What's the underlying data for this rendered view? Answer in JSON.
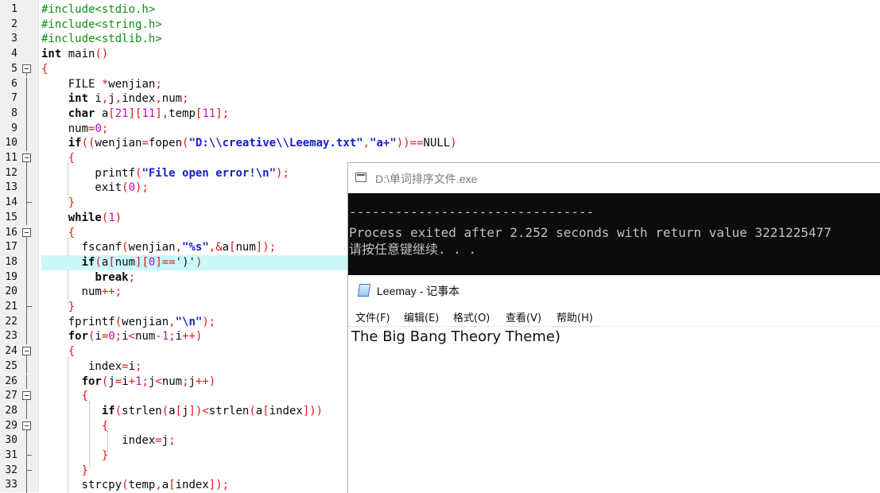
{
  "editor": {
    "lines": [
      {
        "n": "1",
        "fold": "none",
        "segs": [
          {
            "t": "#include<stdio.h>",
            "c": "pp"
          }
        ]
      },
      {
        "n": "2",
        "fold": "none",
        "segs": [
          {
            "t": "#include<string.h>",
            "c": "pp"
          }
        ]
      },
      {
        "n": "3",
        "fold": "none",
        "segs": [
          {
            "t": "#include<stdlib.h>",
            "c": "pp"
          }
        ]
      },
      {
        "n": "4",
        "fold": "none",
        "segs": [
          {
            "t": "int",
            "c": "kw"
          },
          {
            "t": " main",
            "c": ""
          },
          {
            "t": "()",
            "c": "sym"
          }
        ]
      },
      {
        "n": "5",
        "fold": "box",
        "segs": [
          {
            "t": "{",
            "c": "sym"
          }
        ]
      },
      {
        "n": "6",
        "fold": "line",
        "segs": [
          {
            "t": "    FILE ",
            "c": ""
          },
          {
            "t": "*",
            "c": "sym"
          },
          {
            "t": "wenjian",
            "c": ""
          },
          {
            "t": ";",
            "c": "sym"
          }
        ]
      },
      {
        "n": "7",
        "fold": "line",
        "segs": [
          {
            "t": "    ",
            "c": ""
          },
          {
            "t": "int",
            "c": "kw"
          },
          {
            "t": " i",
            "c": ""
          },
          {
            "t": ",",
            "c": "sym"
          },
          {
            "t": "j",
            "c": ""
          },
          {
            "t": ",",
            "c": "sym"
          },
          {
            "t": "index",
            "c": ""
          },
          {
            "t": ",",
            "c": "sym"
          },
          {
            "t": "num",
            "c": ""
          },
          {
            "t": ";",
            "c": "sym"
          }
        ]
      },
      {
        "n": "8",
        "fold": "line",
        "segs": [
          {
            "t": "    ",
            "c": ""
          },
          {
            "t": "char",
            "c": "kw"
          },
          {
            "t": " a",
            "c": ""
          },
          {
            "t": "[",
            "c": "sym"
          },
          {
            "t": "21",
            "c": "num"
          },
          {
            "t": "][",
            "c": "sym"
          },
          {
            "t": "11",
            "c": "num"
          },
          {
            "t": "],",
            "c": "sym"
          },
          {
            "t": "temp",
            "c": ""
          },
          {
            "t": "[",
            "c": "sym"
          },
          {
            "t": "11",
            "c": "num"
          },
          {
            "t": "];",
            "c": "sym"
          }
        ]
      },
      {
        "n": "9",
        "fold": "line",
        "segs": [
          {
            "t": "    num",
            "c": ""
          },
          {
            "t": "=",
            "c": "sym"
          },
          {
            "t": "0",
            "c": "num"
          },
          {
            "t": ";",
            "c": "sym"
          }
        ]
      },
      {
        "n": "10",
        "fold": "line",
        "segs": [
          {
            "t": "    ",
            "c": ""
          },
          {
            "t": "if",
            "c": "kw"
          },
          {
            "t": "((",
            "c": "sym"
          },
          {
            "t": "wenjian",
            "c": ""
          },
          {
            "t": "=",
            "c": "sym"
          },
          {
            "t": "fopen",
            "c": ""
          },
          {
            "t": "(",
            "c": "sym"
          },
          {
            "t": "\"D:\\\\creative\\\\Leemay.txt\"",
            "c": "str"
          },
          {
            "t": ",",
            "c": "sym"
          },
          {
            "t": "\"a+\"",
            "c": "str"
          },
          {
            "t": "))==",
            "c": "sym"
          },
          {
            "t": "NULL",
            "c": ""
          },
          {
            "t": ")",
            "c": "sym"
          }
        ]
      },
      {
        "n": "11",
        "fold": "box",
        "segs": [
          {
            "t": "    ",
            "c": ""
          },
          {
            "t": "{",
            "c": "sym"
          }
        ]
      },
      {
        "n": "12",
        "fold": "line",
        "segs": [
          {
            "t": "        printf",
            "c": ""
          },
          {
            "t": "(",
            "c": "sym"
          },
          {
            "t": "\"File open error!\\n\"",
            "c": "str"
          },
          {
            "t": ");",
            "c": "sym"
          }
        ]
      },
      {
        "n": "13",
        "fold": "line",
        "segs": [
          {
            "t": "        exit",
            "c": ""
          },
          {
            "t": "(",
            "c": "sym"
          },
          {
            "t": "0",
            "c": "num"
          },
          {
            "t": ");",
            "c": "sym"
          }
        ]
      },
      {
        "n": "14",
        "fold": "end",
        "segs": [
          {
            "t": "    ",
            "c": ""
          },
          {
            "t": "}",
            "c": "sym"
          }
        ]
      },
      {
        "n": "15",
        "fold": "line",
        "segs": [
          {
            "t": "    ",
            "c": ""
          },
          {
            "t": "while",
            "c": "kw"
          },
          {
            "t": "(",
            "c": "sym"
          },
          {
            "t": "1",
            "c": "num"
          },
          {
            "t": ")",
            "c": "sym"
          }
        ]
      },
      {
        "n": "16",
        "fold": "box",
        "segs": [
          {
            "t": "    ",
            "c": ""
          },
          {
            "t": "{",
            "c": "sym"
          }
        ]
      },
      {
        "n": "17",
        "fold": "line",
        "segs": [
          {
            "t": "      fscanf",
            "c": ""
          },
          {
            "t": "(",
            "c": "sym"
          },
          {
            "t": "wenjian",
            "c": ""
          },
          {
            "t": ",",
            "c": "sym"
          },
          {
            "t": "\"%s\"",
            "c": "str"
          },
          {
            "t": ",&",
            "c": "sym"
          },
          {
            "t": "a",
            "c": ""
          },
          {
            "t": "[",
            "c": "sym"
          },
          {
            "t": "num",
            "c": ""
          },
          {
            "t": "]);",
            "c": "sym"
          }
        ]
      },
      {
        "n": "18",
        "fold": "line",
        "hl": true,
        "segs": [
          {
            "t": "      ",
            "c": ""
          },
          {
            "t": "if",
            "c": "kw"
          },
          {
            "t": "(",
            "c": "sym"
          },
          {
            "t": "a",
            "c": ""
          },
          {
            "t": "[",
            "c": "sym"
          },
          {
            "t": "num",
            "c": ""
          },
          {
            "t": "][",
            "c": "sym"
          },
          {
            "t": "0",
            "c": "num"
          },
          {
            "t": "]==",
            "c": "sym"
          },
          {
            "t": "')'",
            "c": ""
          },
          {
            "t": ")",
            "c": "sym"
          }
        ]
      },
      {
        "n": "19",
        "fold": "line",
        "segs": [
          {
            "t": "        ",
            "c": ""
          },
          {
            "t": "break",
            "c": "kw"
          },
          {
            "t": ";",
            "c": "sym"
          }
        ]
      },
      {
        "n": "20",
        "fold": "line",
        "segs": [
          {
            "t": "      num",
            "c": ""
          },
          {
            "t": "++;",
            "c": "sym"
          }
        ]
      },
      {
        "n": "21",
        "fold": "end",
        "segs": [
          {
            "t": "    ",
            "c": ""
          },
          {
            "t": "}",
            "c": "sym"
          }
        ]
      },
      {
        "n": "22",
        "fold": "line",
        "segs": [
          {
            "t": "    fprintf",
            "c": ""
          },
          {
            "t": "(",
            "c": "sym"
          },
          {
            "t": "wenjian",
            "c": ""
          },
          {
            "t": ",",
            "c": "sym"
          },
          {
            "t": "\"\\n\"",
            "c": "str"
          },
          {
            "t": ");",
            "c": "sym"
          }
        ]
      },
      {
        "n": "23",
        "fold": "line",
        "segs": [
          {
            "t": "    ",
            "c": ""
          },
          {
            "t": "for",
            "c": "kw"
          },
          {
            "t": "(",
            "c": "sym"
          },
          {
            "t": "i",
            "c": ""
          },
          {
            "t": "=",
            "c": "sym"
          },
          {
            "t": "0",
            "c": "num"
          },
          {
            "t": ";",
            "c": "sym"
          },
          {
            "t": "i",
            "c": ""
          },
          {
            "t": "<",
            "c": "sym"
          },
          {
            "t": "num",
            "c": ""
          },
          {
            "t": "-",
            "c": "sym"
          },
          {
            "t": "1",
            "c": "num"
          },
          {
            "t": ";",
            "c": "sym"
          },
          {
            "t": "i",
            "c": ""
          },
          {
            "t": "++)",
            "c": "sym"
          }
        ]
      },
      {
        "n": "24",
        "fold": "box",
        "segs": [
          {
            "t": "    ",
            "c": ""
          },
          {
            "t": "{",
            "c": "sym"
          }
        ]
      },
      {
        "n": "25",
        "fold": "line",
        "segs": [
          {
            "t": "       index",
            "c": ""
          },
          {
            "t": "=",
            "c": "sym"
          },
          {
            "t": "i",
            "c": ""
          },
          {
            "t": ";",
            "c": "sym"
          }
        ]
      },
      {
        "n": "26",
        "fold": "line",
        "segs": [
          {
            "t": "      ",
            "c": ""
          },
          {
            "t": "for",
            "c": "kw"
          },
          {
            "t": "(",
            "c": "sym"
          },
          {
            "t": "j",
            "c": ""
          },
          {
            "t": "=",
            "c": "sym"
          },
          {
            "t": "i",
            "c": ""
          },
          {
            "t": "+",
            "c": "sym"
          },
          {
            "t": "1",
            "c": "num"
          },
          {
            "t": ";",
            "c": "sym"
          },
          {
            "t": "j",
            "c": ""
          },
          {
            "t": "<",
            "c": "sym"
          },
          {
            "t": "num",
            "c": ""
          },
          {
            "t": ";",
            "c": "sym"
          },
          {
            "t": "j",
            "c": ""
          },
          {
            "t": "++)",
            "c": "sym"
          }
        ]
      },
      {
        "n": "27",
        "fold": "box",
        "segs": [
          {
            "t": "      ",
            "c": ""
          },
          {
            "t": "{",
            "c": "sym"
          }
        ]
      },
      {
        "n": "28",
        "fold": "line",
        "segs": [
          {
            "t": "         ",
            "c": ""
          },
          {
            "t": "if",
            "c": "kw"
          },
          {
            "t": "(",
            "c": "sym"
          },
          {
            "t": "strlen",
            "c": ""
          },
          {
            "t": "(",
            "c": "sym"
          },
          {
            "t": "a",
            "c": ""
          },
          {
            "t": "[",
            "c": "sym"
          },
          {
            "t": "j",
            "c": ""
          },
          {
            "t": "])<",
            "c": "sym"
          },
          {
            "t": "strlen",
            "c": ""
          },
          {
            "t": "(",
            "c": "sym"
          },
          {
            "t": "a",
            "c": ""
          },
          {
            "t": "[",
            "c": "sym"
          },
          {
            "t": "index",
            "c": ""
          },
          {
            "t": "]))",
            "c": "sym"
          }
        ]
      },
      {
        "n": "29",
        "fold": "box",
        "segs": [
          {
            "t": "         ",
            "c": ""
          },
          {
            "t": "{",
            "c": "sym"
          }
        ]
      },
      {
        "n": "30",
        "fold": "line",
        "segs": [
          {
            "t": "            index",
            "c": ""
          },
          {
            "t": "=",
            "c": "sym"
          },
          {
            "t": "j",
            "c": ""
          },
          {
            "t": ";",
            "c": "sym"
          }
        ]
      },
      {
        "n": "31",
        "fold": "end",
        "segs": [
          {
            "t": "         ",
            "c": ""
          },
          {
            "t": "}",
            "c": "sym"
          }
        ]
      },
      {
        "n": "32",
        "fold": "end",
        "segs": [
          {
            "t": "      ",
            "c": ""
          },
          {
            "t": "}",
            "c": "sym"
          }
        ]
      },
      {
        "n": "33",
        "fold": "line",
        "segs": [
          {
            "t": "      strcpy",
            "c": ""
          },
          {
            "t": "(",
            "c": "sym"
          },
          {
            "t": "temp",
            "c": ""
          },
          {
            "t": ",",
            "c": "sym"
          },
          {
            "t": "a",
            "c": ""
          },
          {
            "t": "[",
            "c": "sym"
          },
          {
            "t": "index",
            "c": ""
          },
          {
            "t": "]);",
            "c": "sym"
          }
        ]
      }
    ]
  },
  "console": {
    "title": "D:\\单词排序文件.exe",
    "lines": [
      "--------------------------------",
      "Process exited after 2.252 seconds with return value 3221225477",
      "请按任意键继续. . ."
    ]
  },
  "notepad": {
    "title": "Leemay - 记事本",
    "menu": [
      "文件(F)",
      "编辑(E)",
      "格式(O)",
      "查看(V)",
      "帮助(H)"
    ],
    "content": "The Big Bang Theory Theme)"
  },
  "colors": {
    "preprocessor": "#109010",
    "string": "#1620c8",
    "number": "#b811b8",
    "symbol": "#e01818",
    "highlight_line": "#cbf8fb",
    "console_bg": "#0c0c0c",
    "console_text": "#c0c0c0"
  }
}
